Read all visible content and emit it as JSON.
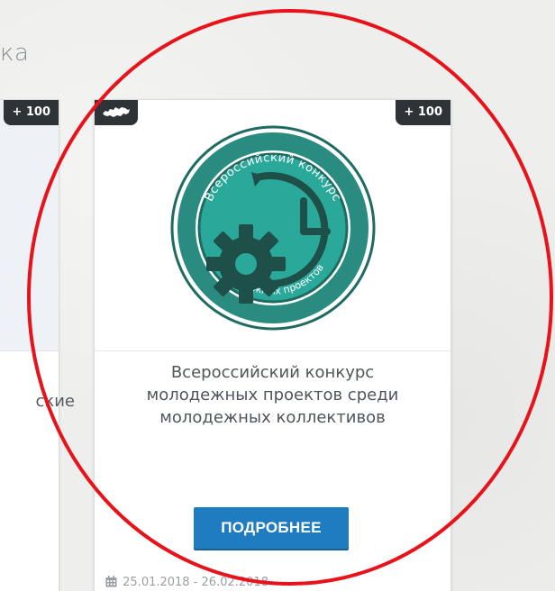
{
  "section": {
    "heading": "ка"
  },
  "left_card": {
    "points": "+ 100",
    "title_fragment": "ские"
  },
  "main_card": {
    "points": "+ 100",
    "region_icon": "russia-map-icon",
    "logo": {
      "ring_text_top": "Всероссийский конкурс",
      "ring_text_bottom": "молодежных проектов",
      "colors": {
        "teal": "#2aa89a",
        "dark_teal": "#1f6b62",
        "ring": "#2a8c80"
      }
    },
    "title": [
      "Всероссийский конкурс",
      "молодежных проектов среди",
      "молодежных коллективов"
    ],
    "button_label": "ПОДРОБНЕЕ",
    "date_range": "25.01.2018 - 26.02.2018",
    "date_icon": "calendar-icon"
  },
  "colors": {
    "button": "#1f7cc1",
    "badge": "#2e3338",
    "annotation": "#e8121a"
  }
}
